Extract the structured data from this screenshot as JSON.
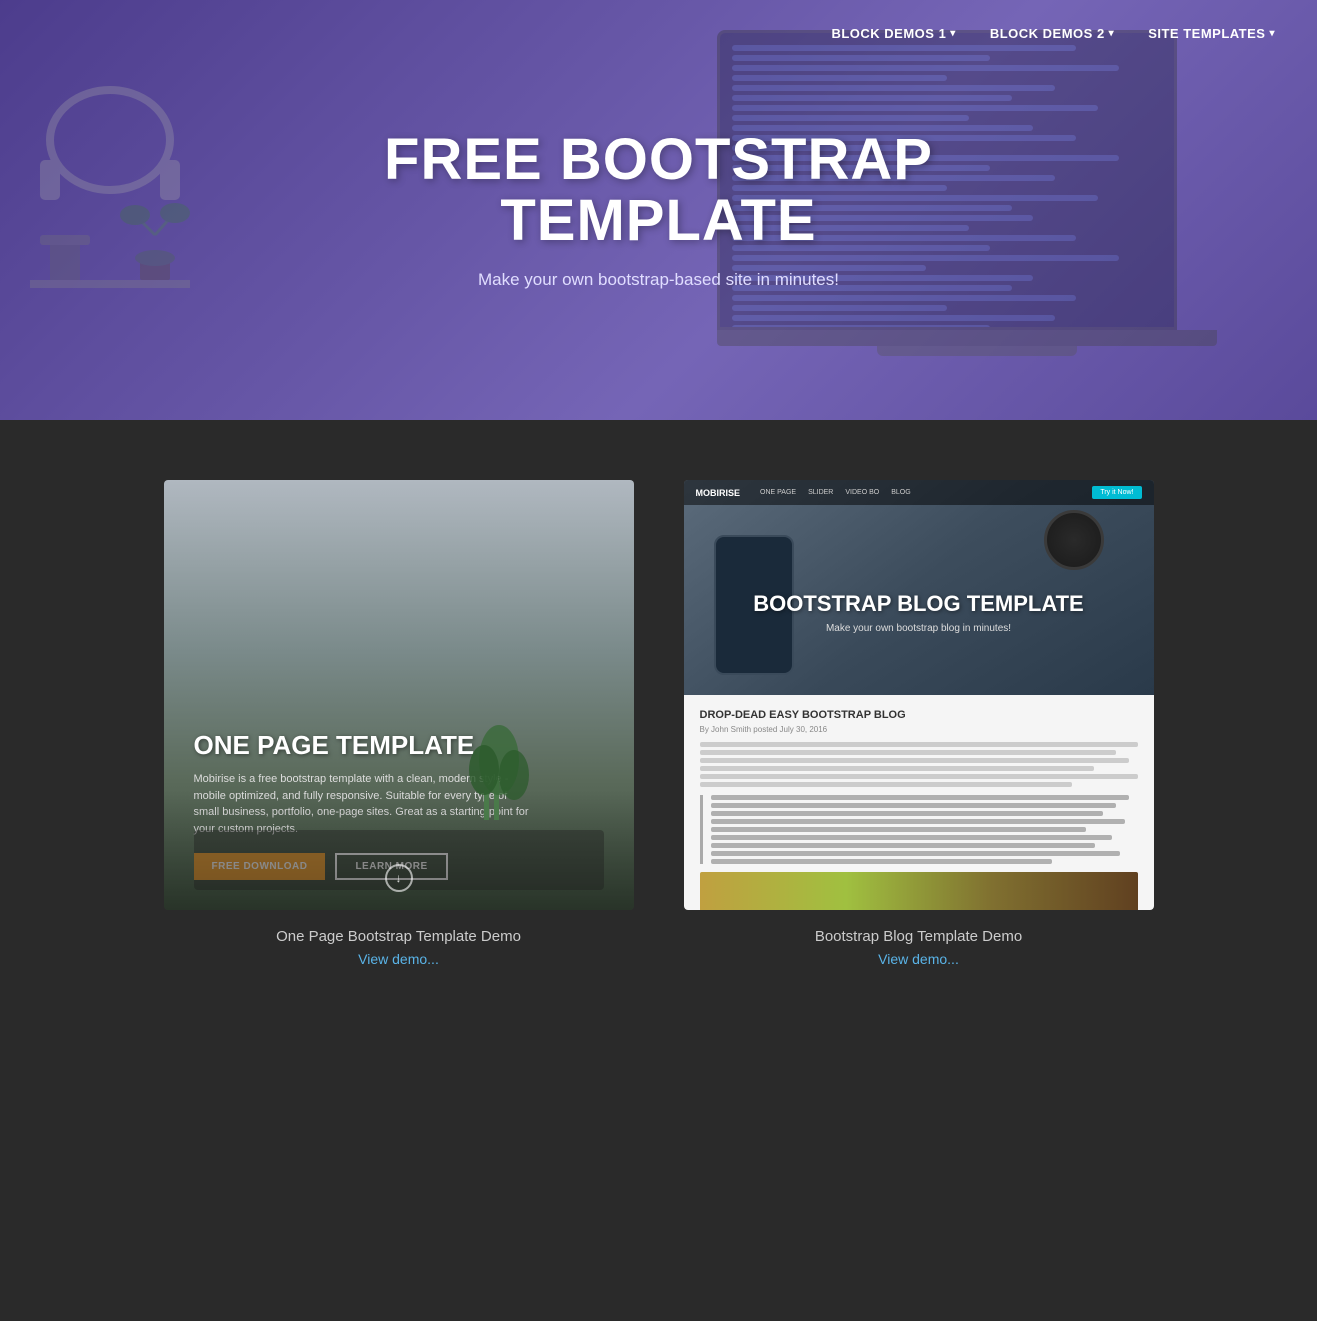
{
  "navbar": {
    "items": [
      {
        "id": "block-demos-1",
        "label": "BLOCK DEMOS 1",
        "hasDropdown": true
      },
      {
        "id": "block-demos-2",
        "label": "BLOCK DEMOS 2",
        "hasDropdown": true
      },
      {
        "id": "site-templates",
        "label": "SITE TEMPLATES",
        "hasDropdown": true
      }
    ]
  },
  "hero": {
    "title": "FREE BOOTSTRAP TEMPLATE",
    "subtitle": "Make your own bootstrap-based site in minutes!"
  },
  "cards": [
    {
      "id": "one-page-template",
      "image_alt": "One Page Template Preview",
      "card_title": "ONE PAGE TEMPLATE",
      "card_text": "Mobirise is a free bootstrap template with a clean, modern style - mobile optimized, and fully responsive. Suitable for every type of small business, portfolio, one-page sites. Great as a starting point for your custom projects.",
      "btn_primary": "FREE DOWNLOAD",
      "btn_secondary": "LEARN MORE",
      "label": "One Page Bootstrap Template Demo",
      "link_text": "View demo..."
    },
    {
      "id": "blog-template",
      "image_alt": "Bootstrap Blog Template Preview",
      "card2_nav_logo": "MOBIRISE",
      "card2_nav_items": [
        "ONE PAGE",
        "SLIDER",
        "VIDEO BO",
        "BLOG"
      ],
      "card2_try_btn": "Try it Now!",
      "card2_title": "BOOTSTRAP BLOG TEMPLATE",
      "card2_subtitle": "Make your own bootstrap blog in minutes!",
      "blog_post_title": "DROP-DEAD EASY BOOTSTRAP BLOG",
      "blog_post_meta": "By John Smith posted July 30, 2016",
      "label": "Bootstrap Blog Template Demo",
      "link_text": "View demo..."
    }
  ],
  "icons": {
    "chevron_down": "▾",
    "arrow_down": "↓"
  }
}
